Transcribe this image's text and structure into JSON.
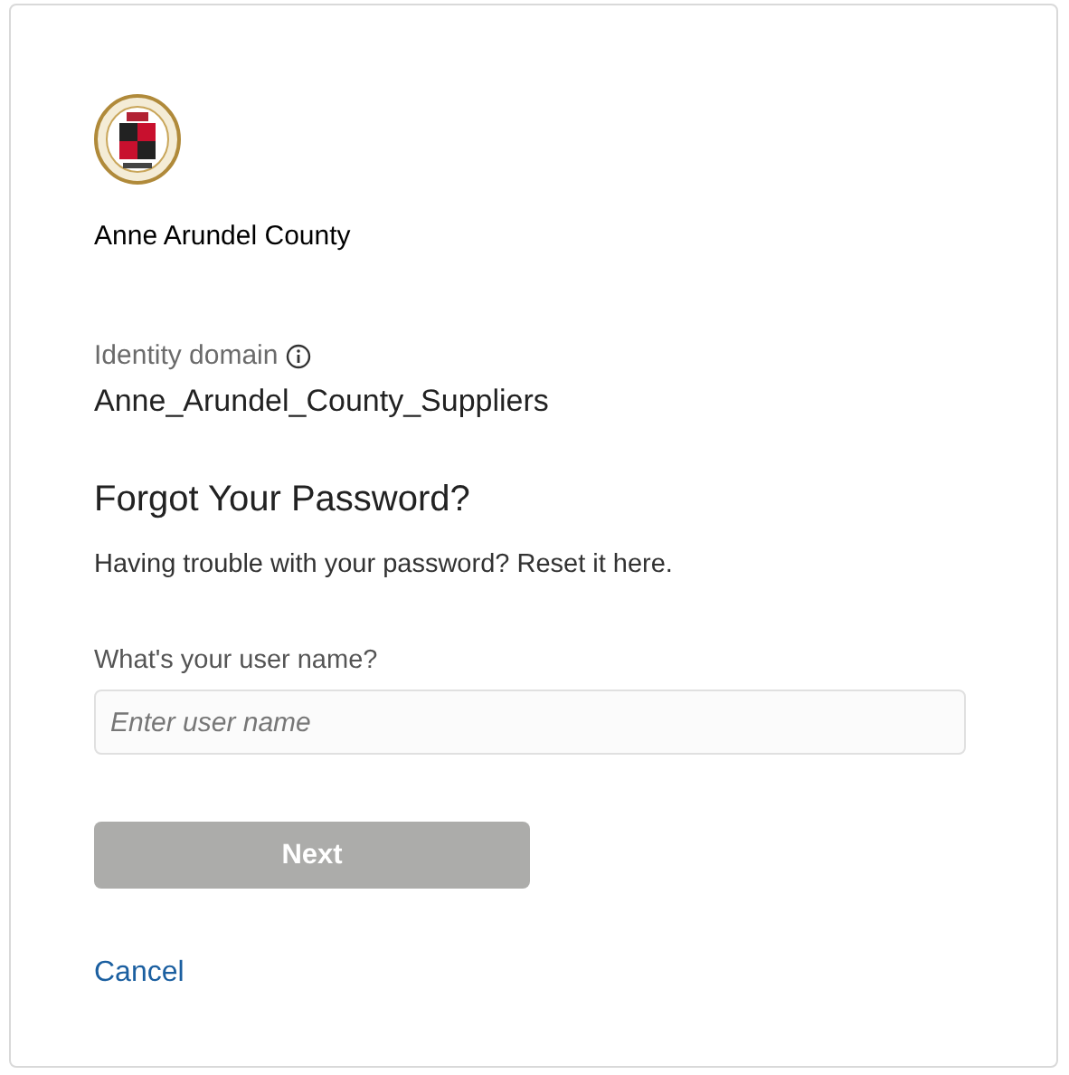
{
  "organization": {
    "name": "Anne Arundel County"
  },
  "identity_domain": {
    "label": "Identity domain",
    "value": "Anne_Arundel_County_Suppliers"
  },
  "heading": "Forgot Your Password?",
  "description": "Having trouble with your password? Reset it here.",
  "username": {
    "label": "What's your user name?",
    "placeholder": "Enter user name"
  },
  "next_button": {
    "label": "Next",
    "disabled": true
  },
  "cancel_link": "Cancel"
}
